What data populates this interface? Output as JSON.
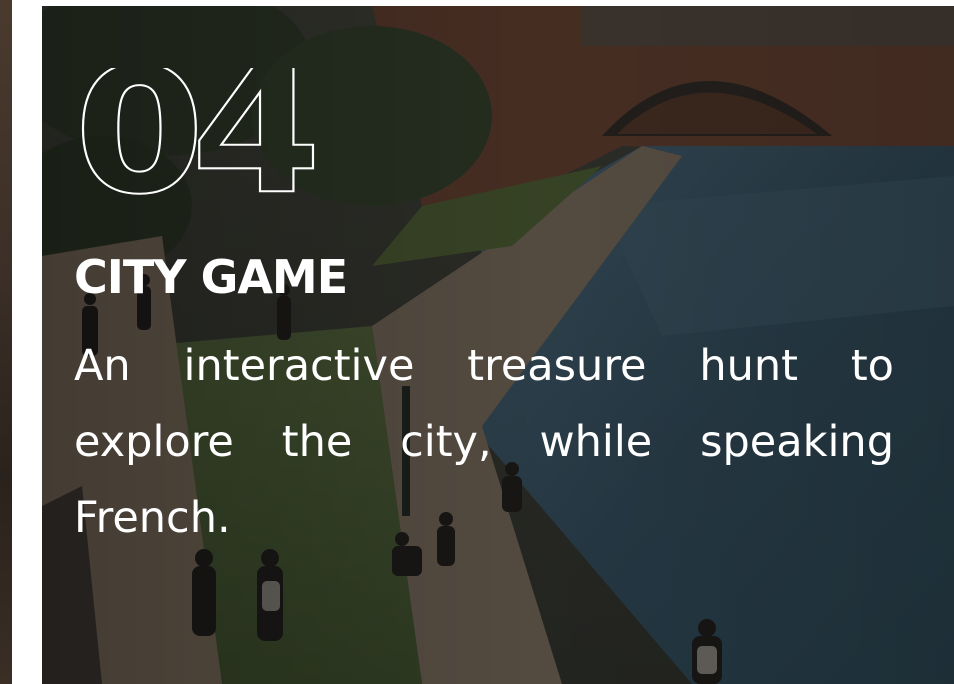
{
  "card": {
    "number": "04",
    "title": "CITY GAME",
    "description": "An interactive treasure hunt to explore the city, while speaking French."
  }
}
